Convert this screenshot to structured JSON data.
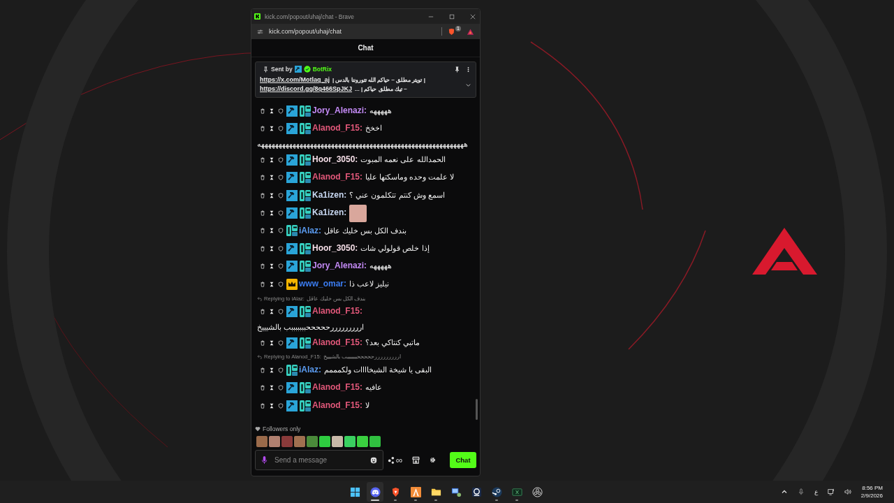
{
  "window": {
    "title": "kick.com/popout/uhaj/chat - Brave",
    "address": "kick.com/popout/uhaj/chat",
    "shield_count": "1"
  },
  "header": {
    "title": "Chat"
  },
  "pinned": {
    "sent_by": "Sent by",
    "sender": "BotRix",
    "lines": [
      {
        "link": "https://x.com/Motlaq_aj",
        "text": "| تويتر مطلق ~ حياكم الله تتوروننا بالدس |"
      },
      {
        "link": "https://discord.gg/8q466SpJKJ",
        "text": "~ تيك مطلق حياكم | ..."
      }
    ]
  },
  "messages": [
    {
      "user": "Jory_Alenazi:",
      "color": "#c38af5",
      "badges": [
        {
          "kind": "mod"
        },
        {
          "kind": "og"
        }
      ],
      "text": "هههههه"
    },
    {
      "user": "Alanod_F15:",
      "color": "#e2587a",
      "badges": [
        {
          "kind": "mod"
        },
        {
          "kind": "og"
        }
      ],
      "text": "اخخخ",
      "more": "هههههههههههههههههههههههههههههههههههههههههههههههههههههههههههه"
    },
    {
      "user": "Hoor_3050:",
      "color": "#f4dde6",
      "badges": [
        {
          "kind": "mod"
        },
        {
          "kind": "og"
        }
      ],
      "text": "الحمدالله على نعمه المبوت"
    },
    {
      "user": "Alanod_F15:",
      "color": "#e2587a",
      "badges": [
        {
          "kind": "mod"
        },
        {
          "kind": "og"
        }
      ],
      "text": "لا علمت وحده وماسكتها عليا"
    },
    {
      "user": "Ka1izen:",
      "color": "#c8d8f2",
      "badges": [
        {
          "kind": "mod"
        },
        {
          "kind": "og"
        }
      ],
      "text": "اسمع وش كنتم تتكلمون عني ؟"
    },
    {
      "user": "Ka1izen:",
      "color": "#c8d8f2",
      "badges": [
        {
          "kind": "mod"
        },
        {
          "kind": "og"
        }
      ],
      "image": true
    },
    {
      "user": "iAlaz:",
      "color": "#5b9cf2",
      "badges": [
        {
          "kind": "og"
        }
      ],
      "text": "بندف الكل بس خليك عاقل"
    },
    {
      "user": "Hoor_3050:",
      "color": "#f4dde6",
      "badges": [
        {
          "kind": "mod"
        },
        {
          "kind": "og"
        }
      ],
      "text": "إذا خلص قولولي شات"
    },
    {
      "user": "Jory_Alenazi:",
      "color": "#c38af5",
      "badges": [
        {
          "kind": "mod"
        },
        {
          "kind": "og"
        }
      ],
      "text": "هههههه"
    },
    {
      "user": "www_omar:",
      "color": "#3b7cf0",
      "badges": [
        {
          "kind": "crown"
        }
      ],
      "text": "نيليز لاعب ذا"
    },
    {
      "user": "Alanod_F15:",
      "color": "#e2587a",
      "badges": [
        {
          "kind": "mod"
        },
        {
          "kind": "og"
        }
      ],
      "more": "ارررررررررحححححبببببببب بالشيييخ",
      "reply": {
        "label": "Replying to iAlaz:",
        "text": "بندف الكل بس خليك عاقل"
      }
    },
    {
      "user": "Alanod_F15:",
      "color": "#e2587a",
      "badges": [
        {
          "kind": "mod"
        },
        {
          "kind": "og"
        }
      ],
      "text": "ماتبي كنتاكي بعد؟"
    },
    {
      "user": "iAlaz:",
      "color": "#5b9cf2",
      "badges": [
        {
          "kind": "og"
        }
      ],
      "text": "البقى يا شيخة الشيخاااات ولكمممم",
      "reply": {
        "label": "Replying to Alanod_F15:",
        "text": "ارررررررررحححححبببببببب بالشيييخ"
      }
    },
    {
      "user": "Alanod_F15:",
      "color": "#e2587a",
      "badges": [
        {
          "kind": "mod"
        },
        {
          "kind": "og"
        }
      ],
      "text": "عافيه"
    },
    {
      "user": "Alanod_F15:",
      "color": "#e2587a",
      "badges": [
        {
          "kind": "mod"
        },
        {
          "kind": "og"
        }
      ],
      "text": "لا"
    }
  ],
  "chat_mode": "Followers only",
  "input": {
    "placeholder": "Send a message"
  },
  "points": "∞",
  "send_button": "Chat",
  "taskbar": [
    {
      "kind": "start",
      "running": false,
      "selected": false
    },
    {
      "kind": "discord",
      "running": true,
      "selected": true
    },
    {
      "kind": "brave",
      "running": true,
      "selected": false
    },
    {
      "kind": "orange",
      "running": true,
      "selected": false
    },
    {
      "kind": "folder",
      "running": true,
      "selected": false
    },
    {
      "kind": "monitor",
      "running": false,
      "selected": false
    },
    {
      "kind": "webcam",
      "running": false,
      "selected": false
    },
    {
      "kind": "steam",
      "running": true,
      "selected": false
    },
    {
      "kind": "sheet",
      "running": true,
      "selected": false
    },
    {
      "kind": "obs",
      "running": false,
      "selected": false
    }
  ],
  "tray": {
    "language": "ع",
    "time": "8:56 PM",
    "date": "2/9/2026"
  }
}
